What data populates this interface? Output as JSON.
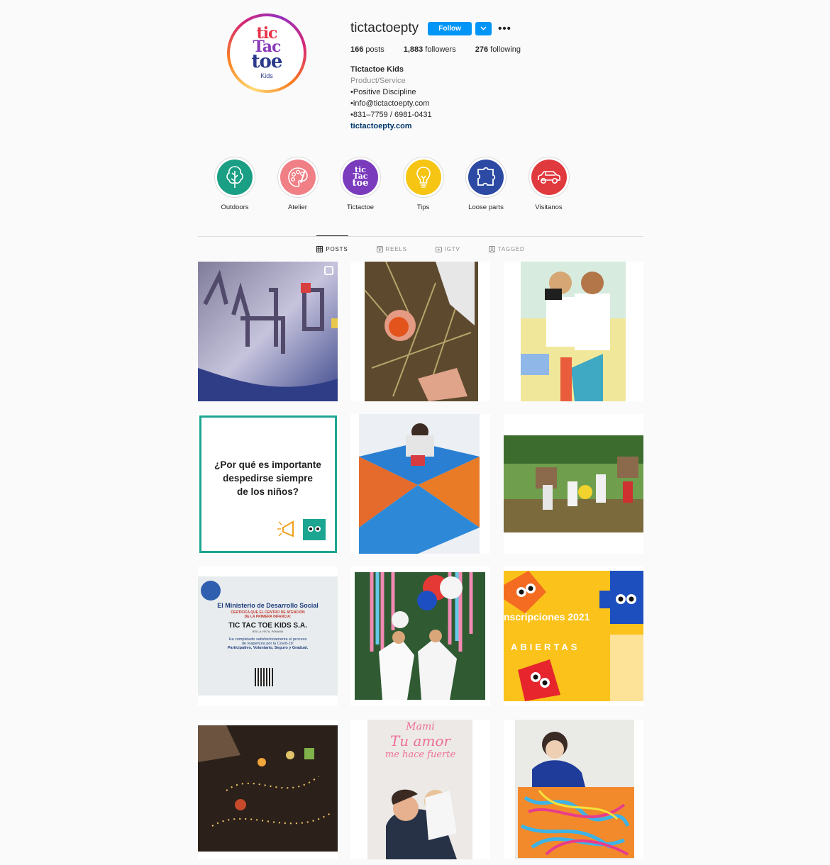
{
  "profile": {
    "username": "tictactoepty",
    "follow_label": "Follow",
    "more_label": "•••",
    "dropdown_label": "⌄",
    "avatar": {
      "line1": "tic",
      "line2": "Tac",
      "line3": "toe",
      "sub": "Kids"
    },
    "stats": {
      "posts": "166",
      "posts_label": " posts",
      "followers": "1,883",
      "followers_label": " followers",
      "following": "276",
      "following_label": " following"
    },
    "bio": {
      "full_name": "Tictactoe Kids",
      "category": "Product/Service",
      "line1": "•Positive Discipline",
      "line2": "•info@tictactoepty.com",
      "line3": "•831–7759 / 6981-0431",
      "link": "tictactoepty.com"
    }
  },
  "highlights": [
    {
      "label": "Outdoors",
      "icon": "tree-icon",
      "color": "#1a9e84"
    },
    {
      "label": "Atelier",
      "icon": "palette-icon",
      "color": "#f07f86"
    },
    {
      "label": "Tictactoe",
      "icon": "tictactoe-logo-icon",
      "color": "#7b3bbd"
    },
    {
      "label": "Tips",
      "icon": "lightbulb-icon",
      "color": "#f6c513"
    },
    {
      "label": "Loose parts",
      "icon": "puzzle-piece-icon",
      "color": "#2c4aa3"
    },
    {
      "label": "Visitanos",
      "icon": "car-icon",
      "color": "#e03a3e"
    }
  ],
  "tabs": [
    {
      "label": "POSTS",
      "icon": "grid-icon",
      "active": true
    },
    {
      "label": "REELS",
      "icon": "reels-icon",
      "active": false
    },
    {
      "label": "IGTV",
      "icon": "igtv-icon",
      "active": false
    },
    {
      "label": "TAGGED",
      "icon": "tagged-icon",
      "active": false
    }
  ],
  "posts": {
    "p4": {
      "line1": "¿Por qué es importante",
      "line2": "despedirse siempre",
      "line3": "de los niños?"
    },
    "p7": {
      "title": "El Ministerio de Desarrollo Social",
      "sub1": "CERTIFICA QUE EL CENTRO DE ATENCIÓN",
      "sub2": "DE LA PRIMERA INFANCIA:",
      "name": "TIC TAC TOE KIDS S.A.",
      "place": "BELLA VISTA, PANAMÁ",
      "body1": "Ha completado satisfactoriamente el proceso",
      "body2": "de reapertura por la Covid-19:",
      "body3": "Participativo, Voluntario, Seguro y Gradual."
    },
    "p9": {
      "line1": "nscripciones 2021",
      "line2": "ABIERTAS"
    },
    "p11": {
      "line1": "Mami",
      "line2": "Tu amor",
      "line3": "me hace fuerte"
    }
  },
  "colors": {
    "accent": "#0095f6",
    "link": "#00376b",
    "muted": "#8e8e8e"
  }
}
